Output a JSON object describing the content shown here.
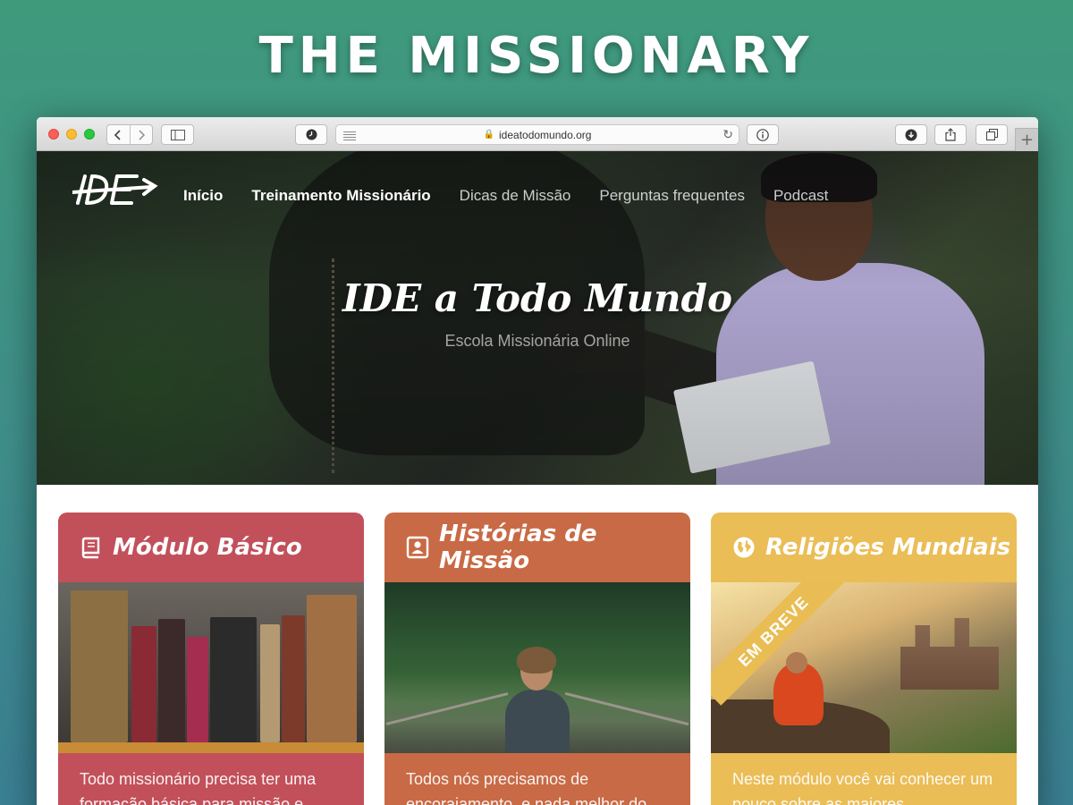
{
  "promo": {
    "title": "THE MISSIONARY"
  },
  "browser": {
    "url": "ideatodomundo.org",
    "back_icon": "chevron-left-icon",
    "forward_icon": "chevron-right-icon"
  },
  "site": {
    "nav": [
      "Início",
      "Treinamento Missionário",
      "Dicas de Missão",
      "Perguntas frequentes",
      "Podcast"
    ],
    "hero_title": "IDE a Todo Mundo",
    "hero_subtitle": "Escola Missionária Online"
  },
  "cards": [
    {
      "title": "Módulo Básico",
      "icon": "book-icon",
      "color": "#c2505a",
      "text": "Todo missionário precisa ter uma formação básica para missão e"
    },
    {
      "title": "Histórias de Missão",
      "icon": "contact-card-icon",
      "color": "#c86a45",
      "text": "Todos nós precisamos de encorajamento, e nada melhor do"
    },
    {
      "title": "Religiões Mundiais",
      "icon": "globe-icon",
      "color": "#eabd56",
      "badge": "EM BREVE",
      "text": "Neste módulo você vai conhecer um pouco sobre as maiores"
    }
  ]
}
